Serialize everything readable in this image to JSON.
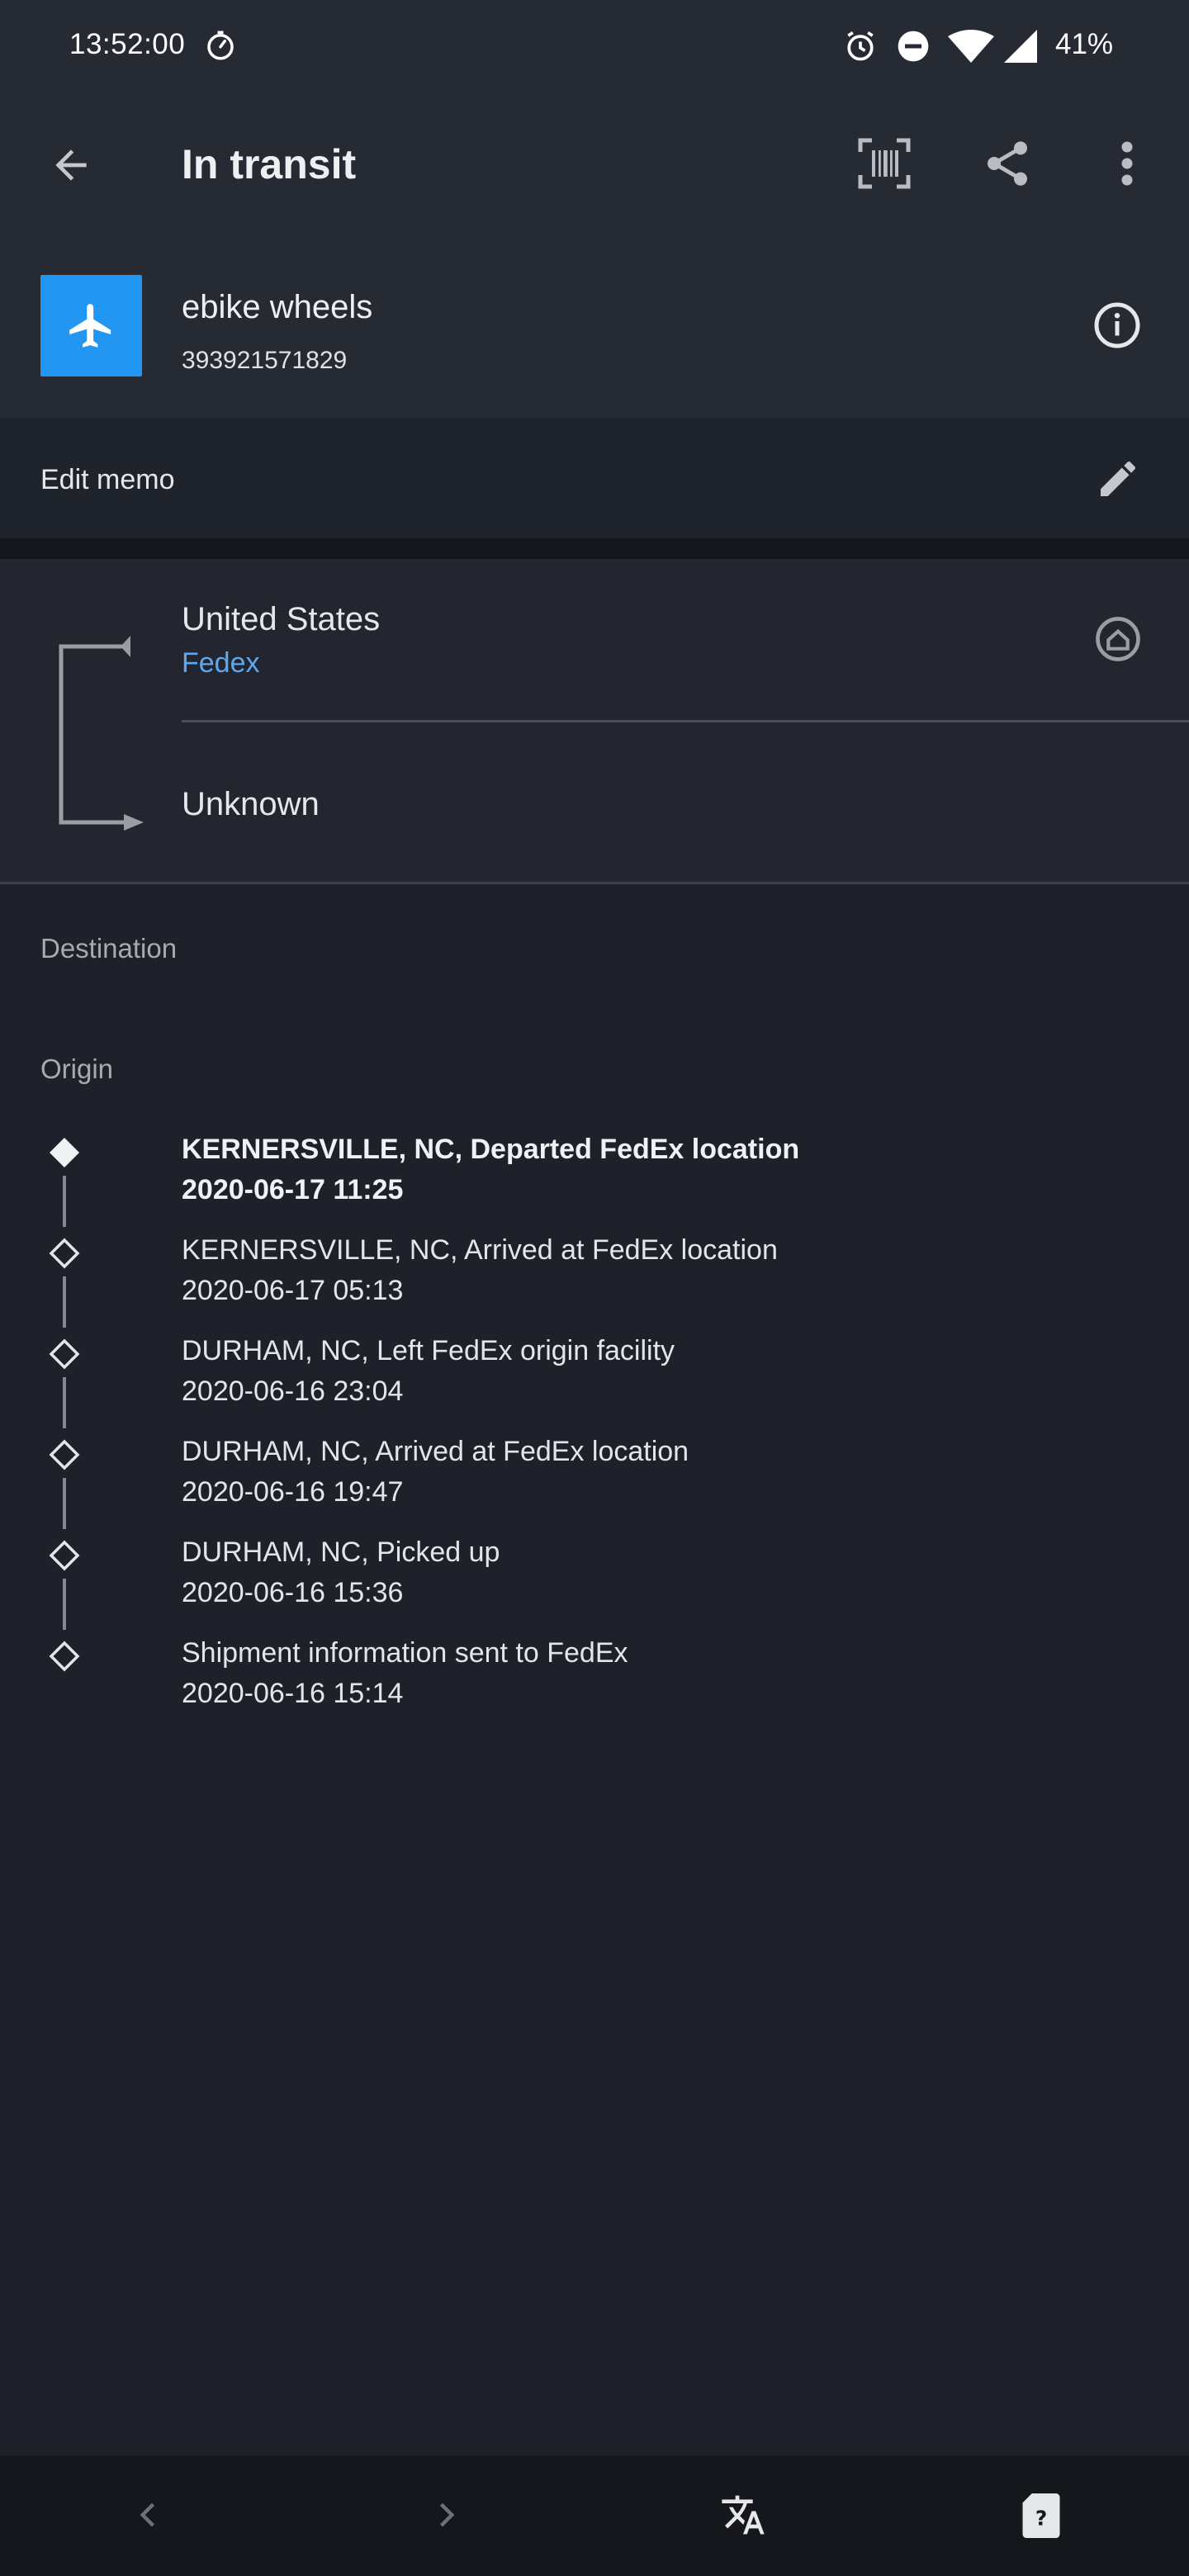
{
  "status_bar": {
    "time": "13:52:00",
    "battery": "41%",
    "icons": [
      "stopwatch-icon",
      "alarm-icon",
      "do-not-disturb-icon",
      "wifi-icon",
      "cell-signal-icon"
    ]
  },
  "app_bar": {
    "title": "In transit",
    "actions": [
      "back-arrow-icon",
      "barcode-scan-icon",
      "share-icon",
      "more-vert-icon"
    ]
  },
  "package": {
    "name": "ebike wheels",
    "tracking_number": "393921571829",
    "icon": "airplane-icon",
    "accent_color": "#2196f3"
  },
  "memo": {
    "label": "Edit memo"
  },
  "route": {
    "origin_country": "United States",
    "carrier": "Fedex",
    "destination_country": "Unknown"
  },
  "sections": {
    "destination_label": "Destination",
    "origin_label": "Origin"
  },
  "events": [
    {
      "description": "KERNERSVILLE, NC, Departed FedEx location",
      "timestamp": "2020-06-17 11:25",
      "latest": true
    },
    {
      "description": "KERNERSVILLE, NC, Arrived at FedEx location",
      "timestamp": "2020-06-17 05:13",
      "latest": false
    },
    {
      "description": "DURHAM, NC, Left FedEx origin facility",
      "timestamp": "2020-06-16 23:04",
      "latest": false
    },
    {
      "description": "DURHAM, NC, Arrived at FedEx location",
      "timestamp": "2020-06-16 19:47",
      "latest": false
    },
    {
      "description": "DURHAM, NC, Picked up",
      "timestamp": "2020-06-16 15:36",
      "latest": false
    },
    {
      "description": "Shipment information sent to FedEx",
      "timestamp": "2020-06-16 15:14",
      "latest": false
    }
  ],
  "bottom_nav": {
    "items": [
      "previous-icon",
      "next-icon",
      "translate-icon",
      "help-card-icon"
    ]
  }
}
